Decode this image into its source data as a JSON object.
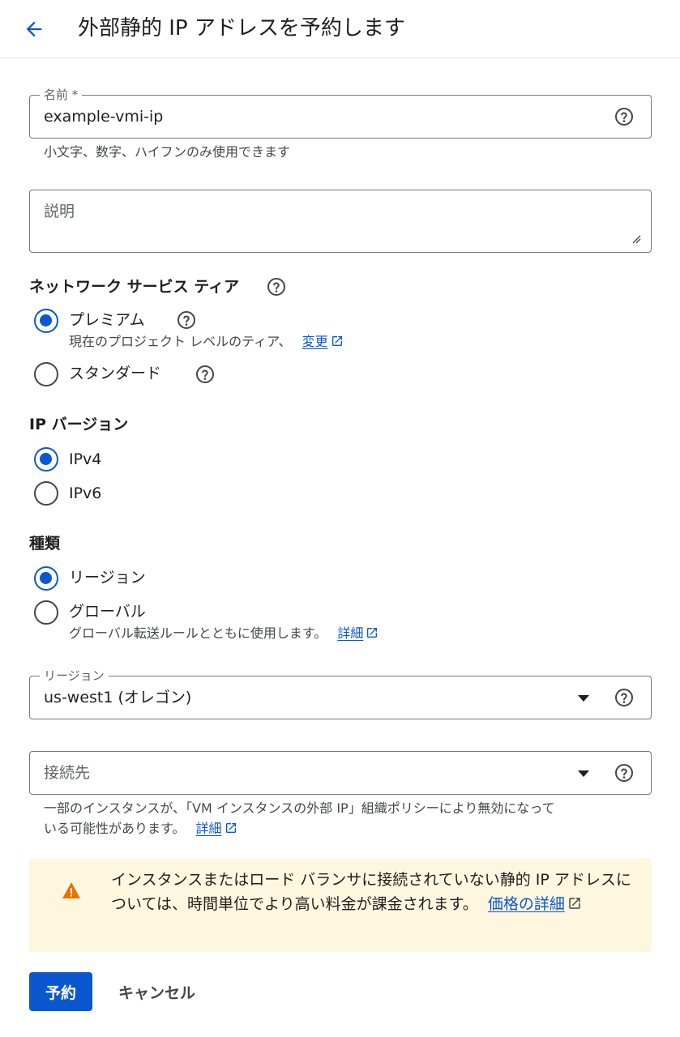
{
  "header": {
    "title": "外部静的 IP アドレスを予約します"
  },
  "name_field": {
    "label": "名前 *",
    "value": "example-vmi-ip",
    "hint": "小文字、数字、ハイフンのみ使用できます"
  },
  "description_field": {
    "placeholder": "説明"
  },
  "network_tier": {
    "title": "ネットワーク サービス ティア",
    "options": [
      {
        "label": "プレミアム",
        "checked": true,
        "sub_text": "現在のプロジェクト レベルのティア、",
        "link": "変更"
      },
      {
        "label": "スタンダード",
        "checked": false
      }
    ]
  },
  "ip_version": {
    "title": "IP バージョン",
    "options": [
      {
        "label": "IPv4",
        "checked": true
      },
      {
        "label": "IPv6",
        "checked": false
      }
    ]
  },
  "type": {
    "title": "種類",
    "options": [
      {
        "label": "リージョン",
        "checked": true
      },
      {
        "label": "グローバル",
        "checked": false,
        "sub_text": "グローバル転送ルールとともに使用します。",
        "link": "詳細"
      }
    ]
  },
  "region_field": {
    "label": "リージョン",
    "value": "us-west1 (オレゴン)"
  },
  "attach_field": {
    "placeholder": "接続先",
    "hint_line1": "一部のインスタンスが、「VM インスタンスの外部 IP」組織ポリシーにより無効になって",
    "hint_line2": "いる可能性があります。",
    "hint_link": "詳細"
  },
  "warning": {
    "text": "インスタンスまたはロード バランサに接続されていない静的 IP アドレスについては、時間単位でより高い料金が課金されます。",
    "link": "価格の詳細"
  },
  "actions": {
    "reserve_label": "予約",
    "cancel_label": "キャンセル"
  },
  "colors": {
    "primary": "#0b57d0",
    "warning_bg": "#fef7e0",
    "warning_icon": "#e37400"
  }
}
